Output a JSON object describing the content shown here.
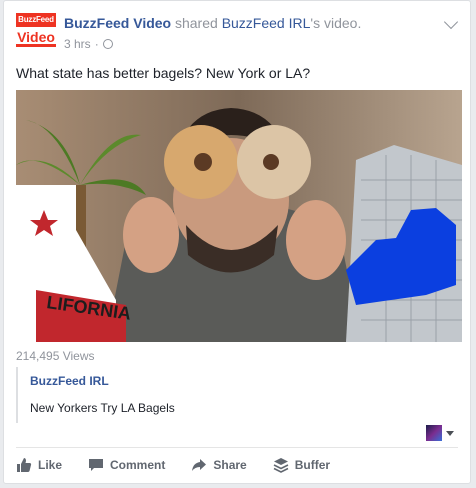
{
  "post": {
    "logo_top": "BuzzFeed",
    "logo_bottom": "Video",
    "author": "BuzzFeed Video",
    "shared_word": "shared",
    "shared_page": "BuzzFeed IRL",
    "shared_suffix": "'s video.",
    "time": "3 hrs",
    "separator": "·",
    "text": "What state has better bagels? New York or LA?",
    "state_label": "LIFORNIA"
  },
  "video": {
    "views": "214,495 Views",
    "source_name": "BuzzFeed IRL",
    "title": "New Yorkers Try LA Bagels"
  },
  "actions": {
    "like": "Like",
    "comment": "Comment",
    "share": "Share",
    "buffer": "Buffer"
  },
  "icons": {
    "audience": "globe-icon",
    "menu": "chevron-down-icon",
    "like": "thumbs-up-icon",
    "comment": "comment-bubble-icon",
    "share": "share-arrow-icon",
    "buffer": "buffer-stack-icon"
  },
  "colors": {
    "link": "#365899",
    "brand_red": "#ee3322",
    "muted": "#90949c",
    "action": "#616770",
    "ny_blue": "#0b3fe0"
  }
}
